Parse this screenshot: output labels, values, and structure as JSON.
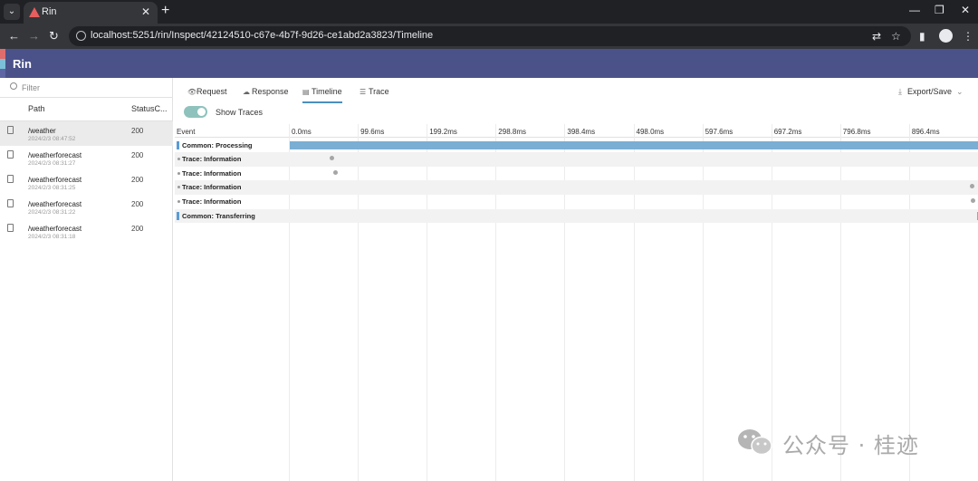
{
  "browser": {
    "tab_title": "Rin",
    "tab_close": "✕",
    "new_tab": "+",
    "url": "localhost:5251/rin/Inspect/42124510-c67e-4b7f-9d26-ce1abd2a3823/Timeline",
    "minimize": "—",
    "restore": "❐",
    "close": "✕"
  },
  "app": {
    "title": "Rin",
    "brand_colors": [
      "#e06c6c",
      "#7bc0d8",
      "#4a5289"
    ]
  },
  "left_panel": {
    "filter_placeholder": "Filter",
    "col_path": "Path",
    "col_status": "StatusC...",
    "requests": [
      {
        "path": "/weather",
        "time": "2024/2/3 08:47:52",
        "status": "200",
        "selected": true
      },
      {
        "path": "/weatherforecast",
        "time": "2024/2/3 08:31:27",
        "status": "200",
        "selected": false
      },
      {
        "path": "/weatherforecast",
        "time": "2024/2/3 08:31:25",
        "status": "200",
        "selected": false
      },
      {
        "path": "/weatherforecast",
        "time": "2024/2/3 08:31:22",
        "status": "200",
        "selected": false
      },
      {
        "path": "/weatherforecast",
        "time": "2024/2/3 08:31:18",
        "status": "200",
        "selected": false
      }
    ]
  },
  "tabs": [
    {
      "label": "Request",
      "icon": "eye-icon",
      "active": false
    },
    {
      "label": "Response",
      "icon": "cloud-icon",
      "active": false
    },
    {
      "label": "Timeline",
      "icon": "timeline-icon",
      "active": true
    },
    {
      "label": "Trace",
      "icon": "document-icon",
      "active": false
    }
  ],
  "export_label": "Export/Save",
  "show_traces": {
    "label": "Show Traces",
    "on": true
  },
  "timeline": {
    "event_header": "Event",
    "ticks": [
      "0.0ms",
      "99.6ms",
      "199.2ms",
      "298.8ms",
      "398.4ms",
      "498.0ms",
      "597.6ms",
      "697.2ms",
      "796.8ms",
      "896.4ms"
    ],
    "events": [
      {
        "label": "Common: Processing",
        "kind": "span",
        "start_ms": 0.0,
        "end_ms": 996.0
      },
      {
        "label": "Trace: Information",
        "kind": "point",
        "at_ms": 60.0
      },
      {
        "label": "Trace: Information",
        "kind": "point",
        "at_ms": 66.0
      },
      {
        "label": "Trace: Information",
        "kind": "point",
        "at_ms": 985.0
      },
      {
        "label": "Trace: Information",
        "kind": "point",
        "at_ms": 990.0
      },
      {
        "label": "Common: Transferring",
        "kind": "span",
        "start_ms": 993.0,
        "end_ms": 996.0
      }
    ]
  },
  "watermark": "公众号 · 桂迹"
}
